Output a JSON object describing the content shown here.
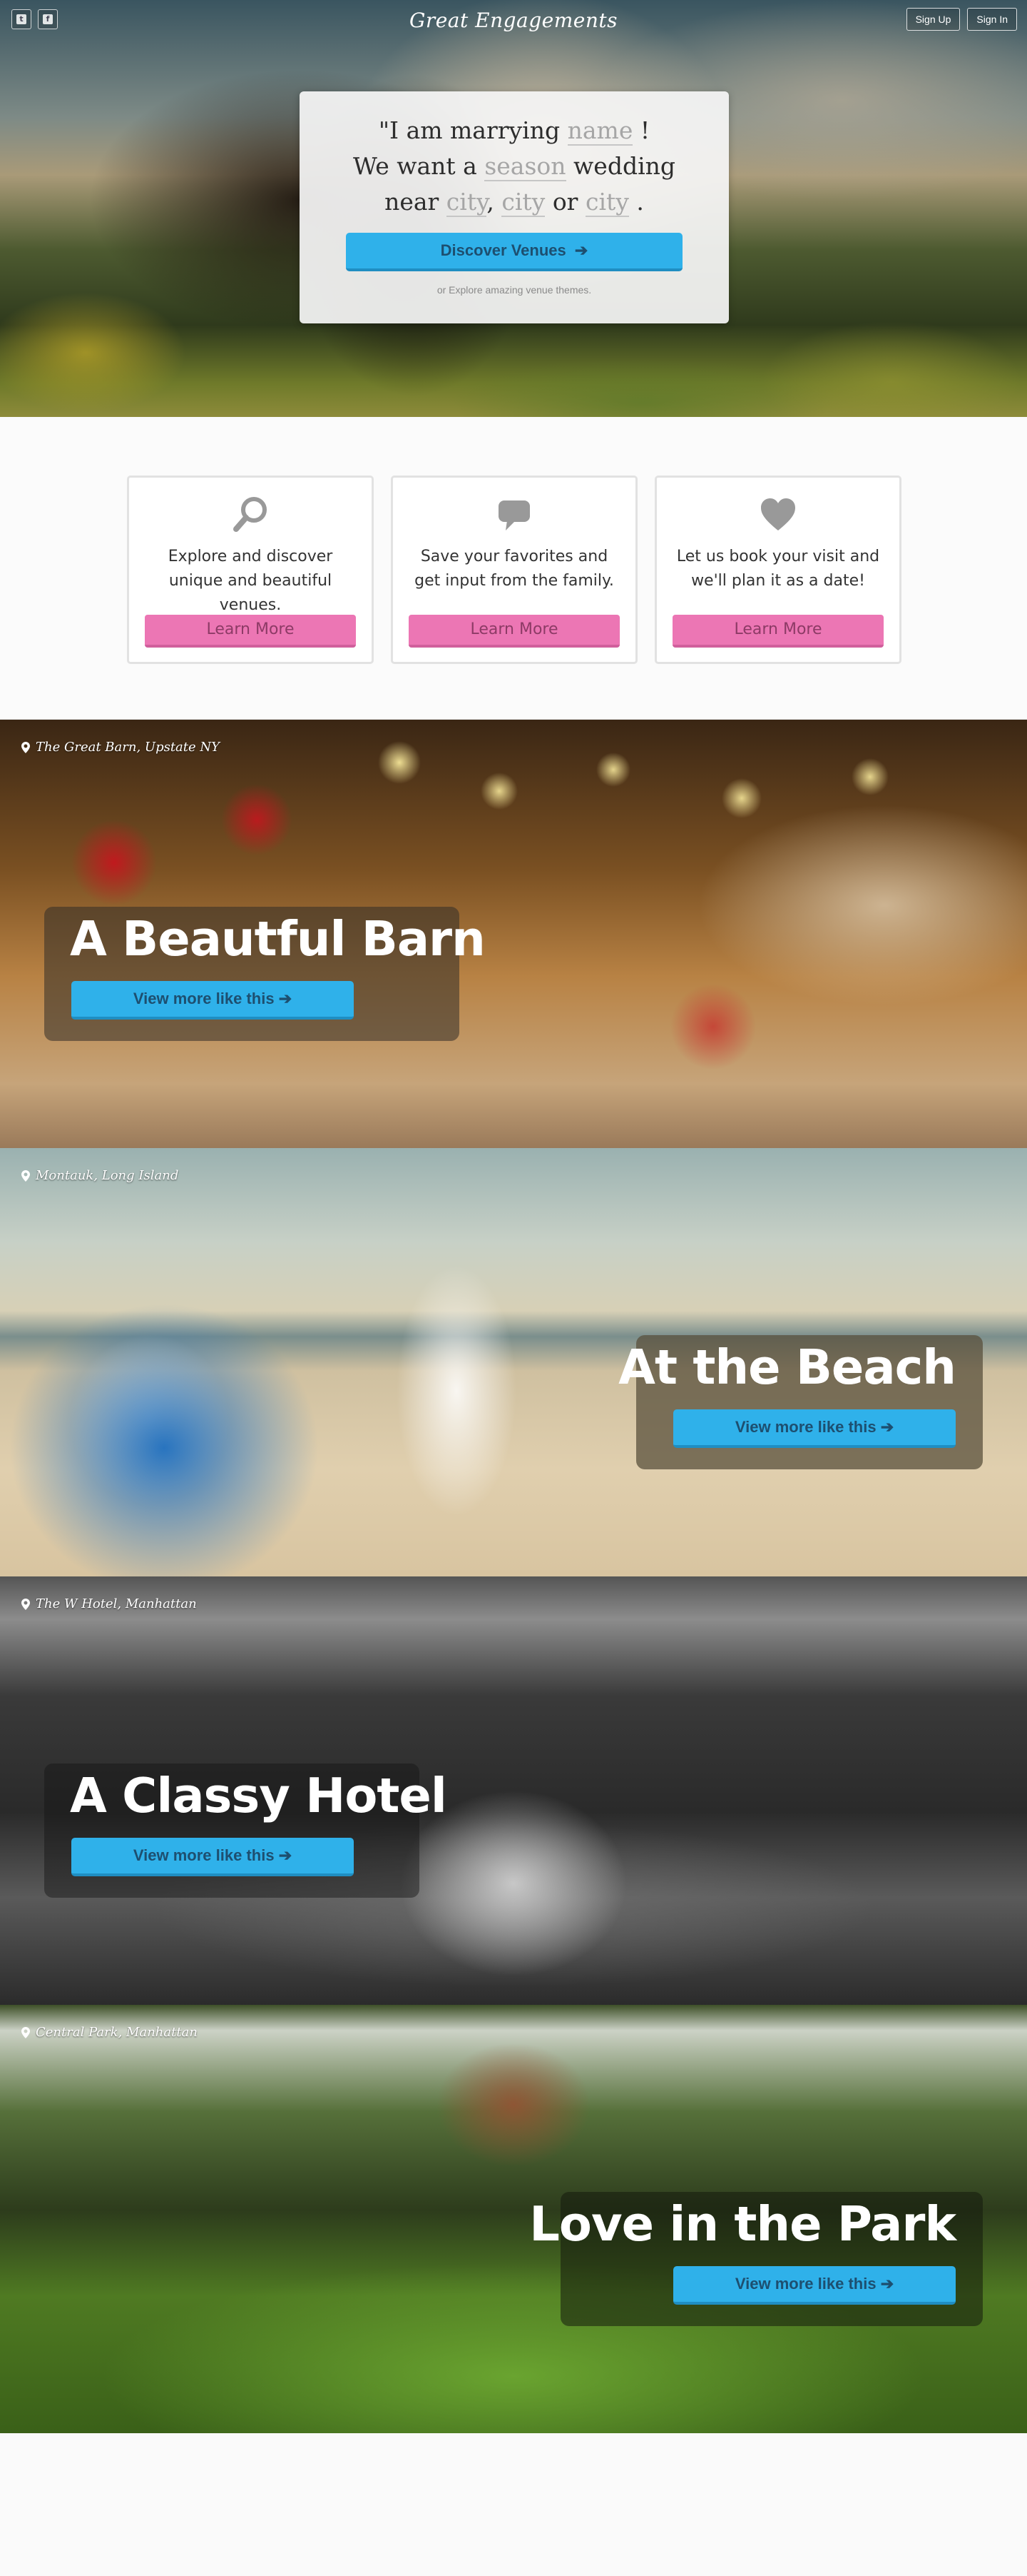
{
  "header": {
    "brand": "Great Engagements",
    "social": [
      {
        "icon": "twitter-icon",
        "glyph": "t"
      },
      {
        "icon": "facebook-icon",
        "glyph": "f"
      }
    ],
    "signup_label": "Sign Up",
    "signin_label": "Sign In"
  },
  "hero": {
    "line1_prefix": "\"I am marrying",
    "line1_fill": "name",
    "line1_suffix": "!",
    "line2_prefix": "We want a",
    "line2_fill": "season",
    "line2_suffix": "wedding",
    "line3_prefix": "near",
    "line3_fill1": "city",
    "line3_sep1": ",",
    "line3_fill2": "city",
    "line3_sep2": "or",
    "line3_fill3": "city",
    "line3_suffix": ".",
    "cta_label": "Discover Venues",
    "cta_arrow": "➔",
    "explore_text": "or Explore amazing venue themes."
  },
  "features": [
    {
      "icon": "search-icon",
      "text": "Explore and discover unique and beautiful venues.",
      "button": "Learn More"
    },
    {
      "icon": "comment-icon",
      "text": "Save your favorites and get input from the family.",
      "button": "Learn More"
    },
    {
      "icon": "heart-icon",
      "text": "Let us book your visit and we'll plan it as a date!",
      "button": "Learn More"
    }
  ],
  "venues": [
    {
      "location": "The Great Barn, Upstate NY",
      "title": "A Beautful Barn",
      "button": "View more like this",
      "arrow": "➔"
    },
    {
      "location": "Montauk, Long Island",
      "title": "At the Beach",
      "button": "View more like this",
      "arrow": "➔"
    },
    {
      "location": "The W Hotel, Manhattan",
      "title": "A Classy Hotel",
      "button": "View more like this",
      "arrow": "➔"
    },
    {
      "location": "Central Park, Manhattan",
      "title": "Love in the Park",
      "button": "View more like this",
      "arrow": "➔"
    }
  ],
  "colors": {
    "accent_blue": "#2fb1ea",
    "accent_pink": "#ec76b4"
  }
}
